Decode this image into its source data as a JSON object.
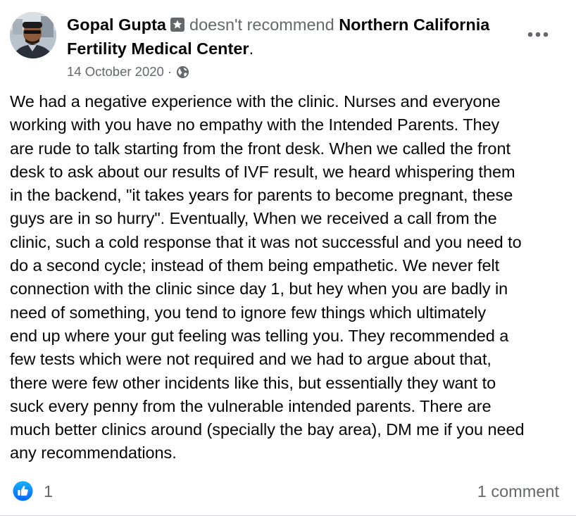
{
  "post": {
    "author_name": "Gopal Gupta",
    "action_text": "doesn't recommend",
    "page_name": "Northern California Fertility Medical Center",
    "period": ".",
    "date": "14 October 2020",
    "separator": "·",
    "privacy_icon": "globe-icon",
    "badge_icon": "star-badge-icon",
    "more_icon": "ellipsis-icon",
    "body": "We had a negative experience with the clinic. Nurses and everyone\nworking with you have no empathy with the Intended Parents. They\nare rude to talk starting from the front desk. When we called the front\ndesk to ask about our results of IVF result, we heard whispering them\nin the backend, \"it takes years for parents to become pregnant, these\nguys are in so hurry\". Eventually, When we received a call from the\nclinic, such a cold response that it was not successful and you need to\ndo a second cycle; instead of them being empathetic. We never felt\nconnection with the clinic since day 1, but hey when you are badly in\nneed of something, you tend to ignore few things which ultimately\nend up where your gut feeling was telling you. They recommended a\nfew tests which were not required and we had to argue about that,\nthere were few other incidents like this, but essentially they want to\nsuck every penny from the vulnerable intended parents. There are\nmuch better clinics around (specially the bay area), DM me if you need\nany recommendations."
  },
  "footer": {
    "like_icon": "thumbs-up-icon",
    "like_count": "1",
    "comment_count": "1 comment"
  },
  "colors": {
    "primary_text": "#050505",
    "secondary_text": "#65676b",
    "like_blue": "#1877f2",
    "badge_gray": "#65676b"
  }
}
